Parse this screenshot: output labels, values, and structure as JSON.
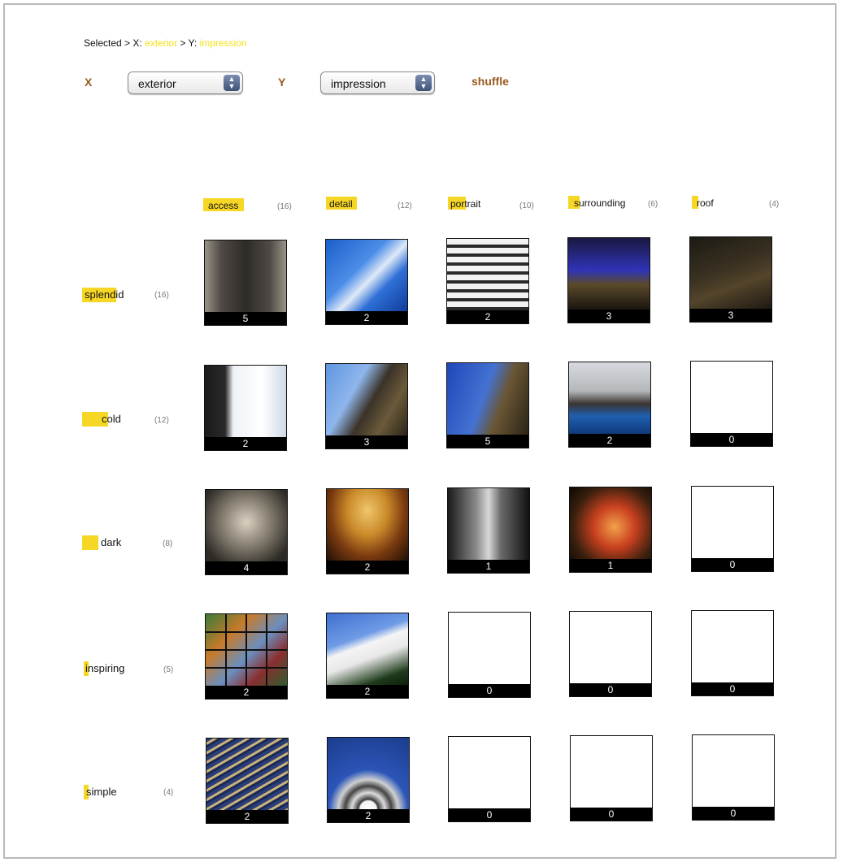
{
  "breadcrumb": {
    "prefix": "Selected > X: ",
    "x_value": "exterior",
    "mid": " > Y: ",
    "y_value": "impression"
  },
  "controls": {
    "x_label": "X",
    "x_value": "exterior",
    "y_label": "Y",
    "y_value": "impression",
    "shuffle_label": "shuffle"
  },
  "columns": [
    {
      "label": "access",
      "count": "(16)"
    },
    {
      "label": "detail",
      "count": "(12)"
    },
    {
      "label": "portrait",
      "count": "(10)"
    },
    {
      "label": "surrounding",
      "count": "(6)"
    },
    {
      "label": "roof",
      "count": "(4)"
    }
  ],
  "rows": [
    {
      "label": "splendid",
      "count": "(16)",
      "cells": [
        "5",
        "2",
        "2",
        "3",
        "3"
      ]
    },
    {
      "label": "cold",
      "count": "(12)",
      "cells": [
        "2",
        "3",
        "5",
        "2",
        "0"
      ]
    },
    {
      "label": "dark",
      "count": "(8)",
      "cells": [
        "4",
        "2",
        "1",
        "1",
        "0"
      ]
    },
    {
      "label": "inspiring",
      "count": "(5)",
      "cells": [
        "2",
        "2",
        "0",
        "0",
        "0"
      ]
    },
    {
      "label": "simple",
      "count": "(4)",
      "cells": [
        "2",
        "2",
        "0",
        "0",
        "0"
      ]
    }
  ],
  "colors": {
    "highlight": "#f6d000",
    "breadcrumb_highlight": "#f3e21a",
    "control_label": "#9a5a1f"
  }
}
